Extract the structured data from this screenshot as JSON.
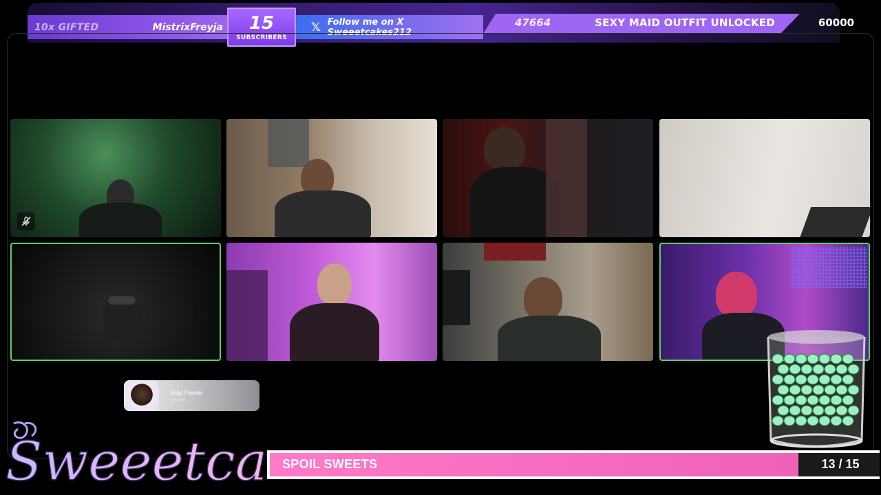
{
  "alerts": {
    "gift_label": "10x GIFTED",
    "gift_user": "MistrixFreyja",
    "subs_count": "15",
    "subs_label": "SUBSCRIBERS",
    "follow_text": "Follow me on X Sweeetcakes212",
    "goal_current": "47664",
    "goal_label": "SEXY MAID OUTFIT UNLOCKED",
    "goal_max": "60000",
    "goal_progress": 0.794
  },
  "cameras": [
    {
      "name": "cam-1",
      "active": false,
      "muted": true
    },
    {
      "name": "cam-2",
      "active": false,
      "muted": false
    },
    {
      "name": "cam-3",
      "active": false,
      "muted": false
    },
    {
      "name": "cam-4",
      "active": false,
      "muted": false
    },
    {
      "name": "cam-5",
      "active": true,
      "muted": false
    },
    {
      "name": "cam-6",
      "active": false,
      "muted": false
    },
    {
      "name": "cam-7",
      "active": false,
      "muted": false
    },
    {
      "name": "cam-8",
      "active": true,
      "muted": false
    }
  ],
  "now_playing": {
    "track": "Baby Powder",
    "artist": "Jenevieve"
  },
  "logo_text": "Sweeetcakes",
  "spoil": {
    "label": "SPOIL SWEETS",
    "count": "13 / 15",
    "progress": 0.867
  },
  "colors": {
    "accent_purple": "#9e66f2",
    "active_border": "#58d46a",
    "spoil_pink": "#f46bc0"
  }
}
